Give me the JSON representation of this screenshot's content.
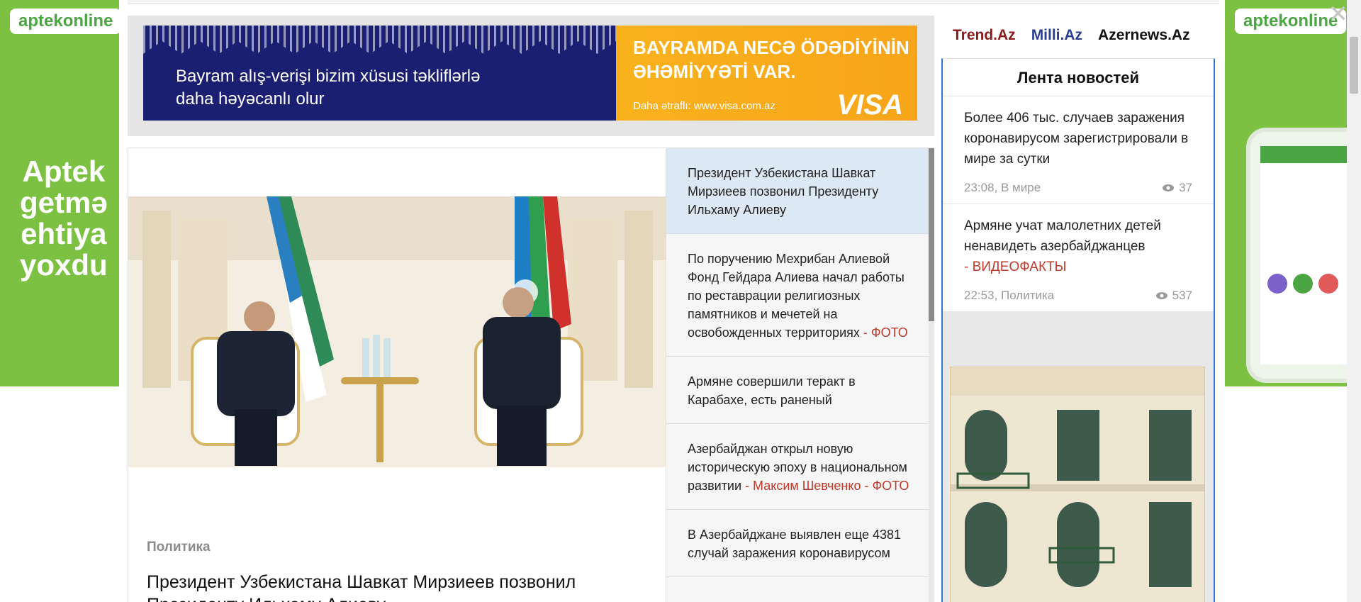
{
  "side_banners": {
    "brand": "aptekonline",
    "left_text": "Aptek\ngetmə\nehtiya\nyoxdu"
  },
  "ad": {
    "left_line1": "Bayram alış-verişi bizim xüsusi təkliflərlə",
    "left_line2": "daha həyəcanlı olur",
    "right_headline1": "BAYRAMDA NECƏ ÖDƏDİYİNİN",
    "right_headline2": "ƏHƏMİYYƏTİ VAR.",
    "more": "Daha ətraflı: www.visa.com.az",
    "brand": "VISA"
  },
  "featured": {
    "category": "Политика",
    "title": "Президент Узбекистана Шавкат Мирзиеев позвонил Президенту Ильхаму Алиеву"
  },
  "news_list": [
    {
      "text": "Президент Узбекистана Шавкат Мирзиеев позвонил Президенту Ильхаму Алиеву",
      "tag": ""
    },
    {
      "text": "По поручению Мехрибан Алиевой Фонд Гейдара Алиева начал работы по реставрации религиозных памятников и мечетей на освобожденных территориях",
      "tag": "- ФОТО"
    },
    {
      "text": "Армяне совершили теракт в Карабахе, есть раненый",
      "tag": ""
    },
    {
      "text": "Азербайджан открыл новую историческую эпоху в национальном развитии",
      "tag": "- Максим Шевченко - ФОТО"
    },
    {
      "text": "В Азербайджане выявлен еще 4381 случай заражения коронавирусом",
      "tag": ""
    }
  ],
  "top_links": {
    "trend": "Trend.Az",
    "milli": "Milli.Az",
    "azernews": "Azernews.Az"
  },
  "feed": {
    "title": "Лента новостей",
    "items": [
      {
        "title": "Более 406 тыс. случаев заражения коронавирусом зарегистрировали в мире за сутки",
        "tag": "",
        "meta": "23:08, В мире",
        "views": "37"
      },
      {
        "title": "Армяне учат малолетних детей ненавидеть азербайджанцев",
        "tag": "- ВИДЕОФАКТЫ",
        "meta": "22:53, Политика",
        "views": "537"
      }
    ]
  }
}
